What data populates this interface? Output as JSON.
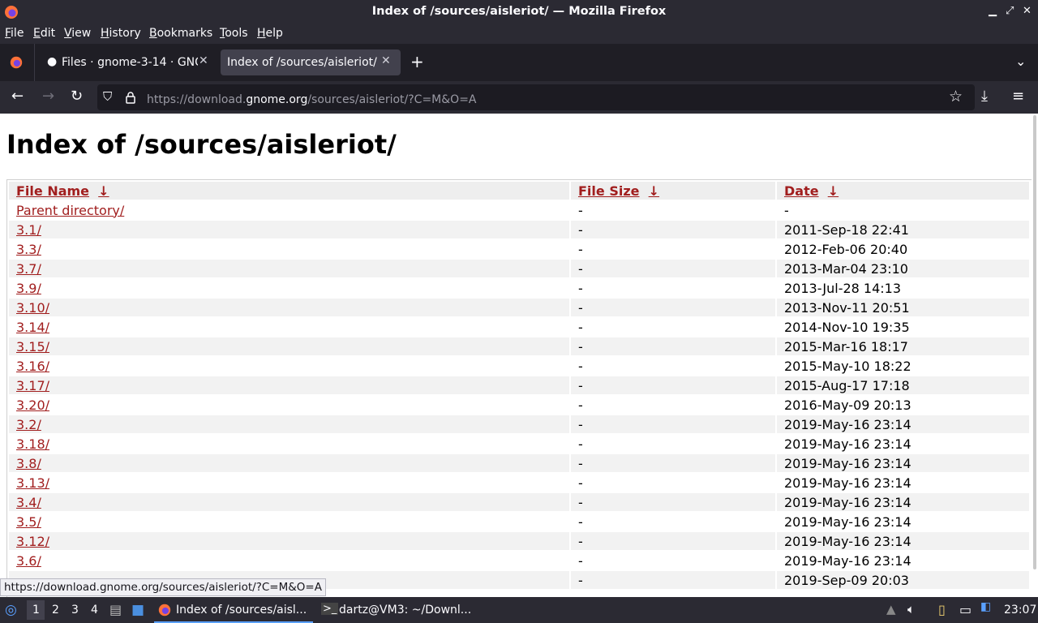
{
  "window": {
    "title": "Index of /sources/aisleriot/ — Mozilla Firefox"
  },
  "menubar": {
    "items": [
      "File",
      "Edit",
      "View",
      "History",
      "Bookmarks",
      "Tools",
      "Help"
    ]
  },
  "tabs": [
    {
      "label": "Files · gnome-3-14 · GNO",
      "active": false
    },
    {
      "label": "Index of /sources/aisleriot/",
      "active": true
    }
  ],
  "url": {
    "scheme": "https://download.",
    "host": "gnome.org",
    "path": "/sources/aisleriot/?C=M&O=A"
  },
  "page": {
    "heading": "Index of /sources/aisleriot/",
    "headers": [
      "File Name",
      "File Size",
      "Date"
    ],
    "sort_arrow": "↓",
    "rows": [
      {
        "name": "Parent directory/",
        "size": "-",
        "date": "-"
      },
      {
        "name": "3.1/",
        "size": "-",
        "date": "2011-Sep-18 22:41"
      },
      {
        "name": "3.3/",
        "size": "-",
        "date": "2012-Feb-06 20:40"
      },
      {
        "name": "3.7/",
        "size": "-",
        "date": "2013-Mar-04 23:10"
      },
      {
        "name": "3.9/",
        "size": "-",
        "date": "2013-Jul-28 14:13"
      },
      {
        "name": "3.10/",
        "size": "-",
        "date": "2013-Nov-11 20:51"
      },
      {
        "name": "3.14/",
        "size": "-",
        "date": "2014-Nov-10 19:35"
      },
      {
        "name": "3.15/",
        "size": "-",
        "date": "2015-Mar-16 18:17"
      },
      {
        "name": "3.16/",
        "size": "-",
        "date": "2015-May-10 18:22"
      },
      {
        "name": "3.17/",
        "size": "-",
        "date": "2015-Aug-17 17:18"
      },
      {
        "name": "3.20/",
        "size": "-",
        "date": "2016-May-09 20:13"
      },
      {
        "name": "3.2/",
        "size": "-",
        "date": "2019-May-16 23:14"
      },
      {
        "name": "3.18/",
        "size": "-",
        "date": "2019-May-16 23:14"
      },
      {
        "name": "3.8/",
        "size": "-",
        "date": "2019-May-16 23:14"
      },
      {
        "name": "3.13/",
        "size": "-",
        "date": "2019-May-16 23:14"
      },
      {
        "name": "3.4/",
        "size": "-",
        "date": "2019-May-16 23:14"
      },
      {
        "name": "3.5/",
        "size": "-",
        "date": "2019-May-16 23:14"
      },
      {
        "name": "3.12/",
        "size": "-",
        "date": "2019-May-16 23:14"
      },
      {
        "name": "3.6/",
        "size": "-",
        "date": "2019-May-16 23:14"
      },
      {
        "name": "",
        "size": "-",
        "date": "2019-Sep-09 20:03"
      }
    ]
  },
  "status_link": "https://download.gnome.org/sources/aisleriot/?C=M&O=A",
  "taskbar": {
    "workspaces": [
      "1",
      "2",
      "3",
      "4"
    ],
    "windows": [
      "Index of /sources/aisl...",
      "dartz@VM3: ~/Downl..."
    ],
    "clock": "23:07"
  },
  "colors": {
    "chrome": "#2b2a33",
    "link": "#a11e1e",
    "url_bar": "#1c1b22"
  }
}
